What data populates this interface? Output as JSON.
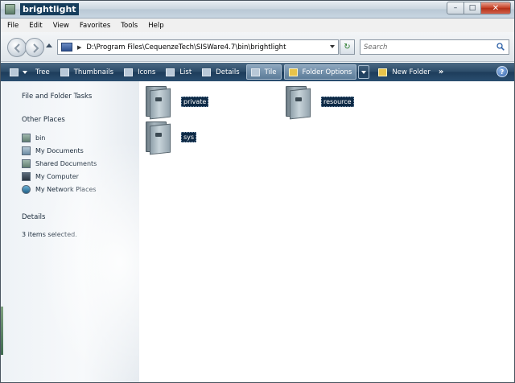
{
  "window": {
    "title": "brightlight",
    "minimize_glyph": "–",
    "maximize_glyph": "□",
    "close_glyph": "✕"
  },
  "menu": {
    "items": [
      "File",
      "Edit",
      "View",
      "Favorites",
      "Tools",
      "Help"
    ]
  },
  "address": {
    "path": "D:\\Program Files\\CequenzeTech\\SISWare4.7\\bin\\brightlight",
    "arrow_glyph": "▶",
    "refresh_glyph": "↻"
  },
  "search": {
    "placeholder": "Search"
  },
  "toolbar": {
    "items": [
      {
        "label": "Tree",
        "icon": "tree-view-icon"
      },
      {
        "label": "Thumbnails",
        "icon": "thumbnails-icon"
      },
      {
        "label": "Icons",
        "icon": "icons-view-icon"
      },
      {
        "label": "List",
        "icon": "list-view-icon"
      },
      {
        "label": "Details",
        "icon": "details-view-icon"
      },
      {
        "label": "Tile",
        "icon": "tile-view-icon",
        "active": true
      },
      {
        "label": "Folder Options",
        "icon": "folder-options-icon"
      },
      {
        "label": "New Folder",
        "icon": "new-folder-icon"
      }
    ],
    "more_glyph": "»",
    "help_glyph": "?"
  },
  "taskpane": {
    "file_folder_tasks": "File and Folder Tasks",
    "other_places": "Other Places",
    "places": [
      {
        "label": "bin",
        "icon": "folder-icon"
      },
      {
        "label": "My Documents",
        "icon": "my-documents-icon"
      },
      {
        "label": "Shared Documents",
        "icon": "shared-documents-icon"
      },
      {
        "label": "My Computer",
        "icon": "my-computer-icon"
      },
      {
        "label": "My Network Places",
        "icon": "network-places-icon"
      }
    ],
    "details_heading": "Details",
    "details_text": "3 items selected."
  },
  "content": {
    "folders": [
      {
        "name": "private"
      },
      {
        "name": "resource"
      },
      {
        "name": "sys"
      }
    ]
  },
  "colors": {
    "toolbar_bg": "#1d3c5a",
    "selection_bg": "#0e2a46",
    "close_button": "#c53d22"
  }
}
